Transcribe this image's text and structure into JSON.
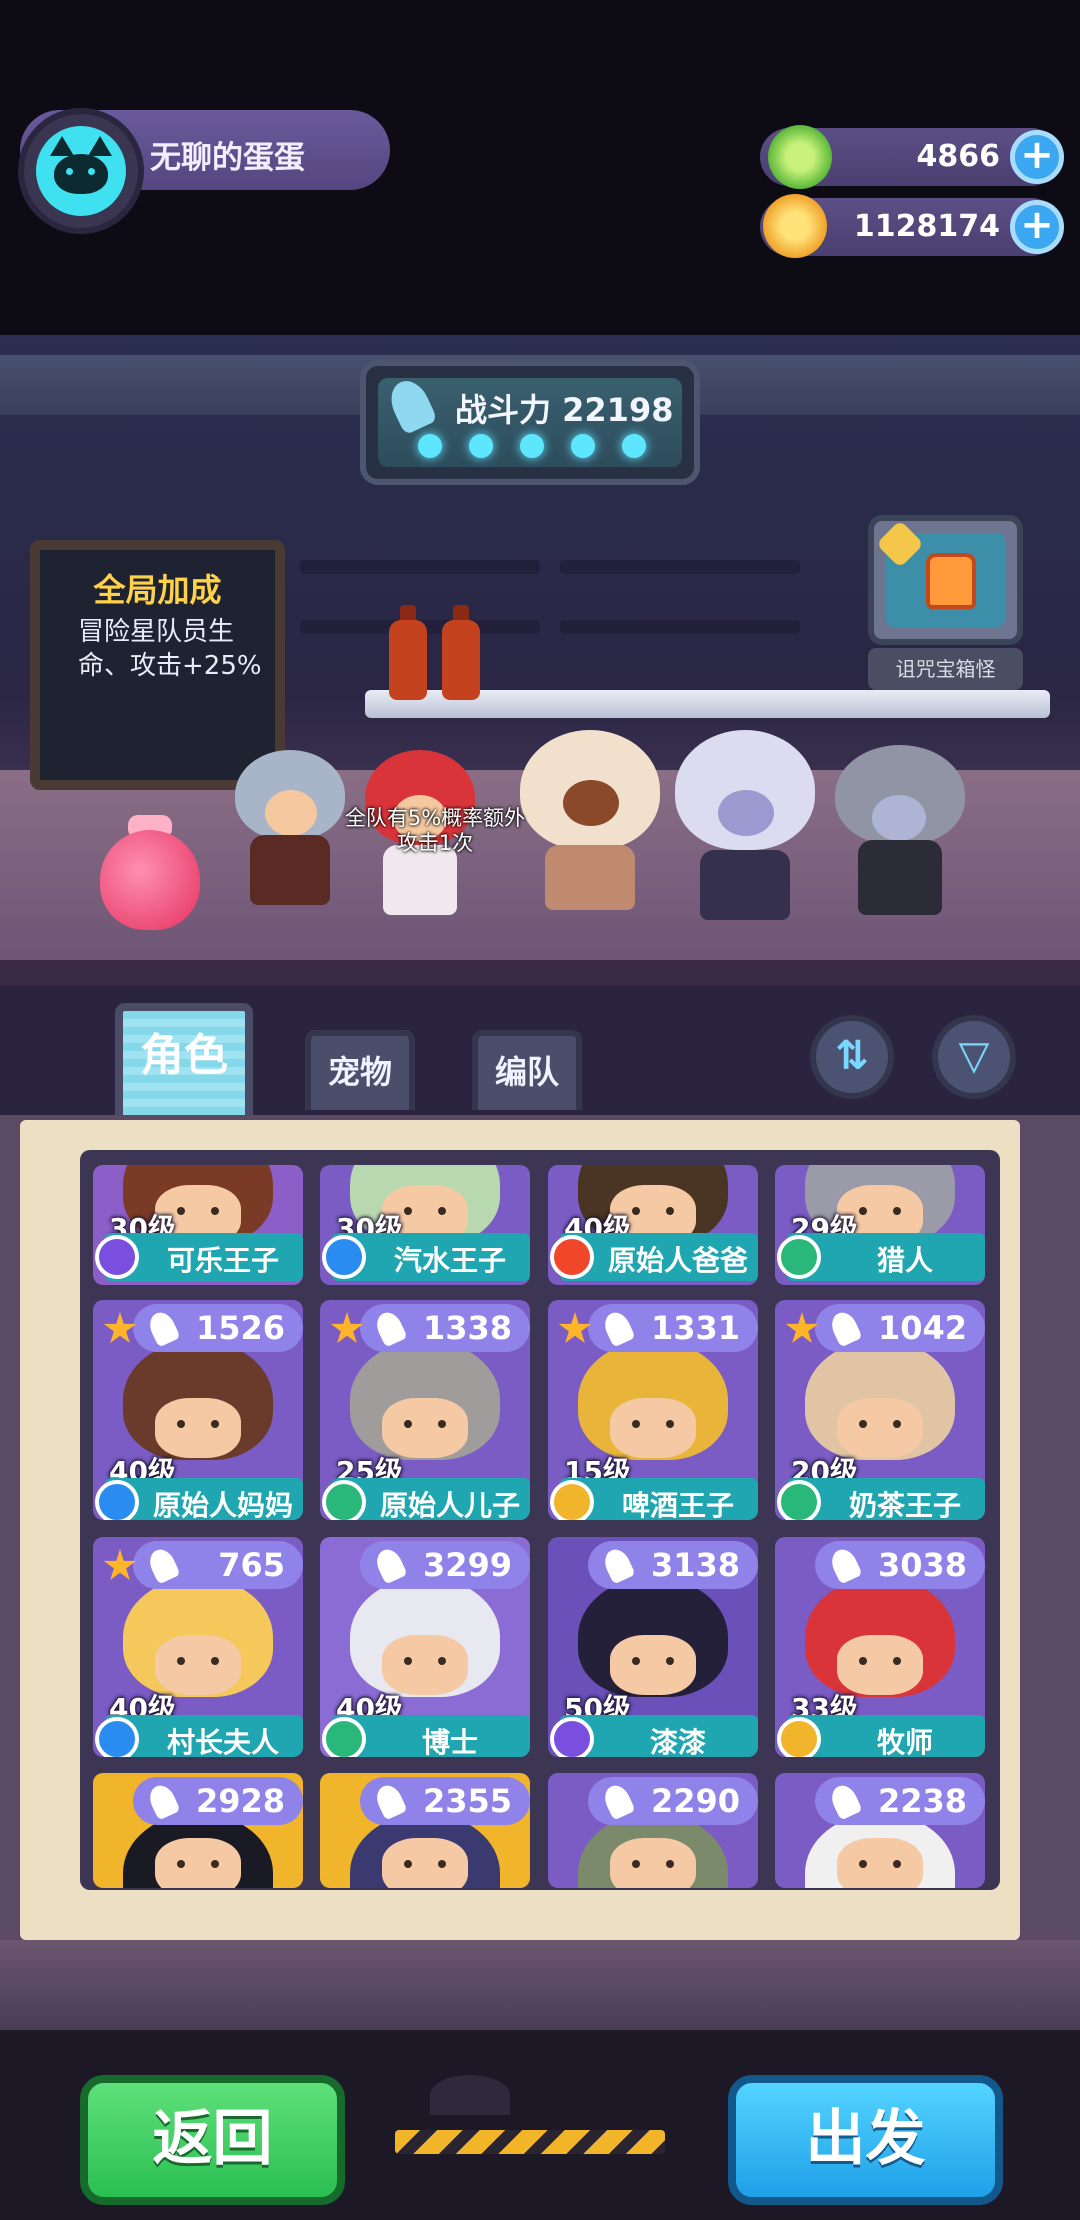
{
  "player": {
    "name": "无聊的蛋蛋"
  },
  "currency": [
    {
      "value": "4866",
      "icon": "green-gem-icon",
      "color": "#6fd14a"
    },
    {
      "value": "1128174",
      "icon": "gold-coin-icon",
      "color": "#ffb72a"
    }
  ],
  "power": {
    "label": "战斗力 22198"
  },
  "bonus_board": {
    "title": "全局加成",
    "text": "冒险星队员生命、攻击+25%"
  },
  "tv": {
    "label": "诅咒宝箱怪"
  },
  "bubble": {
    "text": "全队有5%概率额外攻击1次"
  },
  "tabs": [
    {
      "label": "角色",
      "active": true
    },
    {
      "label": "宠物",
      "active": false
    },
    {
      "label": "编队",
      "active": false
    }
  ],
  "tools": {
    "sort_icon": "sort-icon",
    "filter_icon": "filter-icon"
  },
  "characters": [
    {
      "level": "30级",
      "name": "可乐王子",
      "power": "",
      "elem_color": "#7a4fe0",
      "bg": "#8c5ec8",
      "hair": "#7a3a26"
    },
    {
      "level": "30级",
      "name": "汽水王子",
      "power": "",
      "elem_color": "#2a8cf0",
      "bg": "#7a5cc4",
      "hair": "#b8d8b0"
    },
    {
      "level": "40级",
      "name": "原始人爸爸",
      "power": "",
      "elem_color": "#f0472a",
      "bg": "#7a5cc4",
      "hair": "#4a3424"
    },
    {
      "level": "29级",
      "name": "猎人",
      "power": "",
      "elem_color": "#2ab87a",
      "bg": "#7a5cc4",
      "hair": "#9a9aa8"
    },
    {
      "level": "40级",
      "name": "原始人妈妈",
      "power": "1526",
      "elem_color": "#2a8cf0",
      "bg": "#7a5cc4",
      "hair": "#6a3a2a",
      "star": true
    },
    {
      "level": "25级",
      "name": "原始人儿子",
      "power": "1338",
      "elem_color": "#2ab87a",
      "bg": "#7a5cc4",
      "hair": "#a09c9c",
      "star": true
    },
    {
      "level": "15级",
      "name": "啤酒王子",
      "power": "1331",
      "elem_color": "#f0b52a",
      "bg": "#7a5cc4",
      "hair": "#e8b43a",
      "star": true
    },
    {
      "level": "20级",
      "name": "奶茶王子",
      "power": "1042",
      "elem_color": "#2ab87a",
      "bg": "#7a5cc4",
      "hair": "#e0c4a4",
      "star": true
    },
    {
      "level": "40级",
      "name": "村长夫人",
      "power": "765",
      "elem_color": "#2a8cf0",
      "bg": "#7a5cc4",
      "hair": "#f4c85a",
      "star": true
    },
    {
      "level": "40级",
      "name": "博士",
      "power": "3299",
      "elem_color": "#2ab87a",
      "bg": "#8a6cd4",
      "hair": "#e8e8f0"
    },
    {
      "level": "50级",
      "name": "漆漆",
      "power": "3138",
      "elem_color": "#7a4fe0",
      "bg": "#6a50b8",
      "hair": "#24203a"
    },
    {
      "level": "33级",
      "name": "牧师",
      "power": "3038",
      "elem_color": "#f0b52a",
      "bg": "#7a5cc4",
      "hair": "#d8343a"
    },
    {
      "level": "",
      "name": "",
      "power": "2928",
      "elem_color": "",
      "bg": "#f0b52a",
      "hair": "#1a1a24"
    },
    {
      "level": "",
      "name": "",
      "power": "2355",
      "elem_color": "",
      "bg": "#f0b52a",
      "hair": "#3a3a70"
    },
    {
      "level": "",
      "name": "",
      "power": "2290",
      "elem_color": "",
      "bg": "#7a5cc4",
      "hair": "#7a8a6a"
    },
    {
      "level": "",
      "name": "",
      "power": "2238",
      "elem_color": "",
      "bg": "#7a5cc4",
      "hair": "#f0f0f0"
    }
  ],
  "buttons": {
    "back": "返回",
    "go": "出发"
  },
  "colors": {
    "accent_cyan": "#5fe6ff",
    "namebar": "#1fa6b0",
    "power_badge": "#8f82e8",
    "back_green": "#2bbf52",
    "go_blue": "#1fa0e8"
  }
}
